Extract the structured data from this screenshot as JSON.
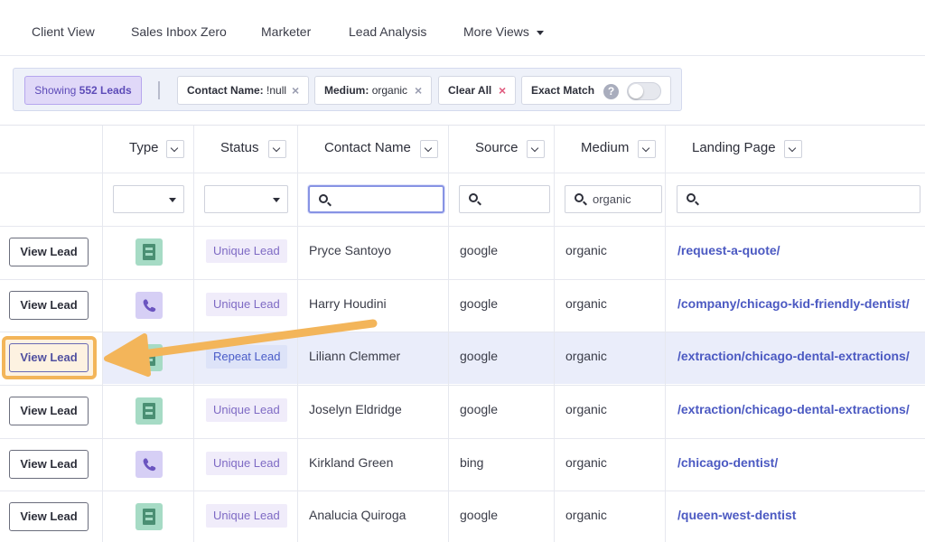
{
  "nav": {
    "tabs": [
      "Client View",
      "Sales Inbox Zero",
      "Marketer",
      "Lead Analysis",
      "More Views"
    ]
  },
  "filters": {
    "showing_prefix": "Showing",
    "showing_count": "552 Leads",
    "chips": [
      {
        "key": "Contact Name:",
        "value": "!null",
        "remove": "×"
      },
      {
        "key": "Medium:",
        "value": "organic",
        "remove": "×"
      },
      {
        "key": "Clear All",
        "value": "",
        "remove": "×"
      },
      {
        "key": "Exact Match",
        "value": "",
        "remove": ""
      }
    ],
    "help": "?",
    "exact_match_on": false
  },
  "table": {
    "columns": [
      "Type",
      "Status",
      "Contact Name",
      "Source",
      "Medium",
      "Landing Page"
    ],
    "column_filters": {
      "medium_value": "organic"
    },
    "view_button_label": "View Lead",
    "rows": [
      {
        "type": "form",
        "status": "Unique Lead",
        "contact": "Pryce Santoyo",
        "source": "google",
        "medium": "organic",
        "landing": "/request-a-quote/"
      },
      {
        "type": "phone",
        "status": "Unique Lead",
        "contact": "Harry Houdini",
        "source": "google",
        "medium": "organic",
        "landing": "/company/chicago-kid-friendly-dentist/"
      },
      {
        "type": "form",
        "status": "Repeat Lead",
        "contact": "Liliann Clemmer",
        "source": "google",
        "medium": "organic",
        "landing": "/extraction/chicago-dental-extractions/"
      },
      {
        "type": "form",
        "status": "Unique Lead",
        "contact": "Joselyn Eldridge",
        "source": "google",
        "medium": "organic",
        "landing": "/extraction/chicago-dental-extractions/"
      },
      {
        "type": "phone",
        "status": "Unique Lead",
        "contact": "Kirkland Green",
        "source": "bing",
        "medium": "organic",
        "landing": "/chicago-dentist/"
      },
      {
        "type": "form",
        "status": "Unique Lead",
        "contact": "Analucia Quiroga",
        "source": "google",
        "medium": "organic",
        "landing": "/queen-west-dentist"
      }
    ],
    "highlighted_row": 2
  },
  "colors": {
    "accent": "#4b59c2",
    "highlight_row": "#eaedfa",
    "callout": "#f3b55a"
  }
}
